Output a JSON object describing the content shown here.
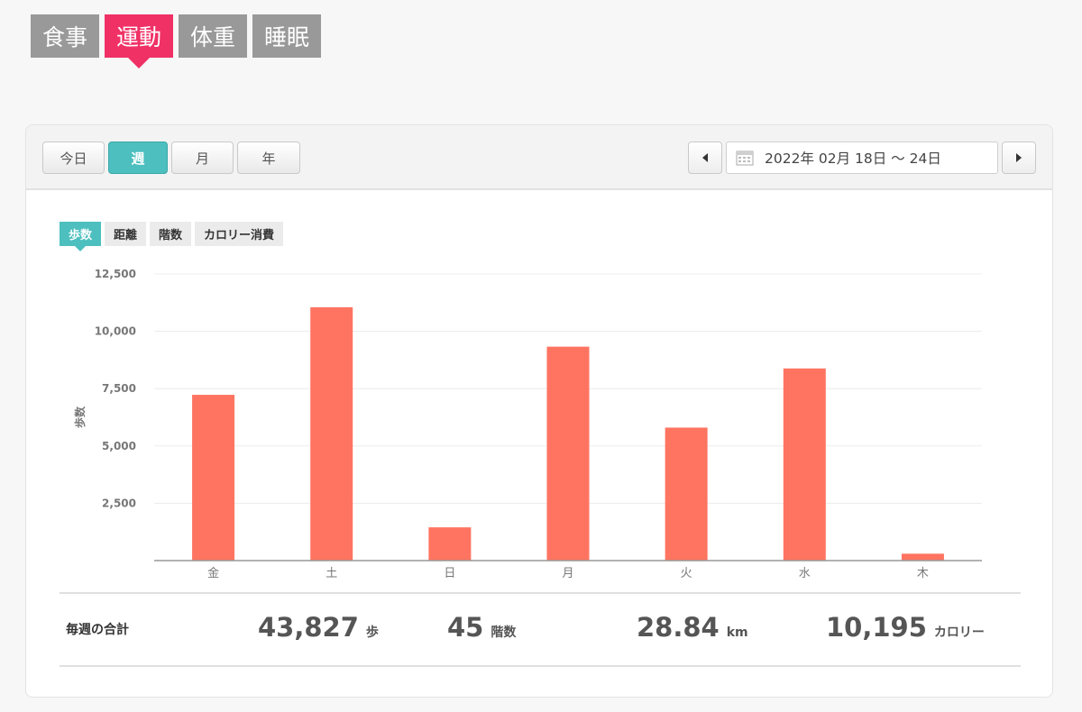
{
  "categories": [
    {
      "label": "食事",
      "active": false
    },
    {
      "label": "運動",
      "active": true
    },
    {
      "label": "体重",
      "active": false
    },
    {
      "label": "睡眠",
      "active": false
    }
  ],
  "period": {
    "buttons": [
      {
        "label": "今日",
        "active": false
      },
      {
        "label": "週",
        "active": true
      },
      {
        "label": "月",
        "active": false
      },
      {
        "label": "年",
        "active": false
      }
    ],
    "date_range": "2022年 02月 18日 ～ 24日"
  },
  "metrics": [
    {
      "label": "歩数",
      "active": true
    },
    {
      "label": "距離",
      "active": false
    },
    {
      "label": "階数",
      "active": false
    },
    {
      "label": "カロリー消費",
      "active": false
    }
  ],
  "chart_data": {
    "type": "bar",
    "categories": [
      "金",
      "土",
      "日",
      "月",
      "火",
      "水",
      "木"
    ],
    "values": [
      7230,
      11050,
      1450,
      9330,
      5800,
      8380,
      300
    ],
    "ylabel": "歩数",
    "ylim": [
      0,
      12500
    ],
    "yticks": [
      "2,500",
      "5,000",
      "7,500",
      "10,000",
      "12,500"
    ],
    "grid": true,
    "bar_color": "#ff7461"
  },
  "summary": {
    "label": "毎週の合計",
    "steps": {
      "value": "43,827",
      "unit": "歩"
    },
    "floors": {
      "value": "45",
      "unit": "階数"
    },
    "distance": {
      "value": "28.84",
      "unit": "km"
    },
    "calories": {
      "value": "10,195",
      "unit": "カロリー"
    }
  },
  "colors": {
    "category_active": "#f03166",
    "category_inactive": "#999999",
    "accent": "#4dbfbf"
  }
}
